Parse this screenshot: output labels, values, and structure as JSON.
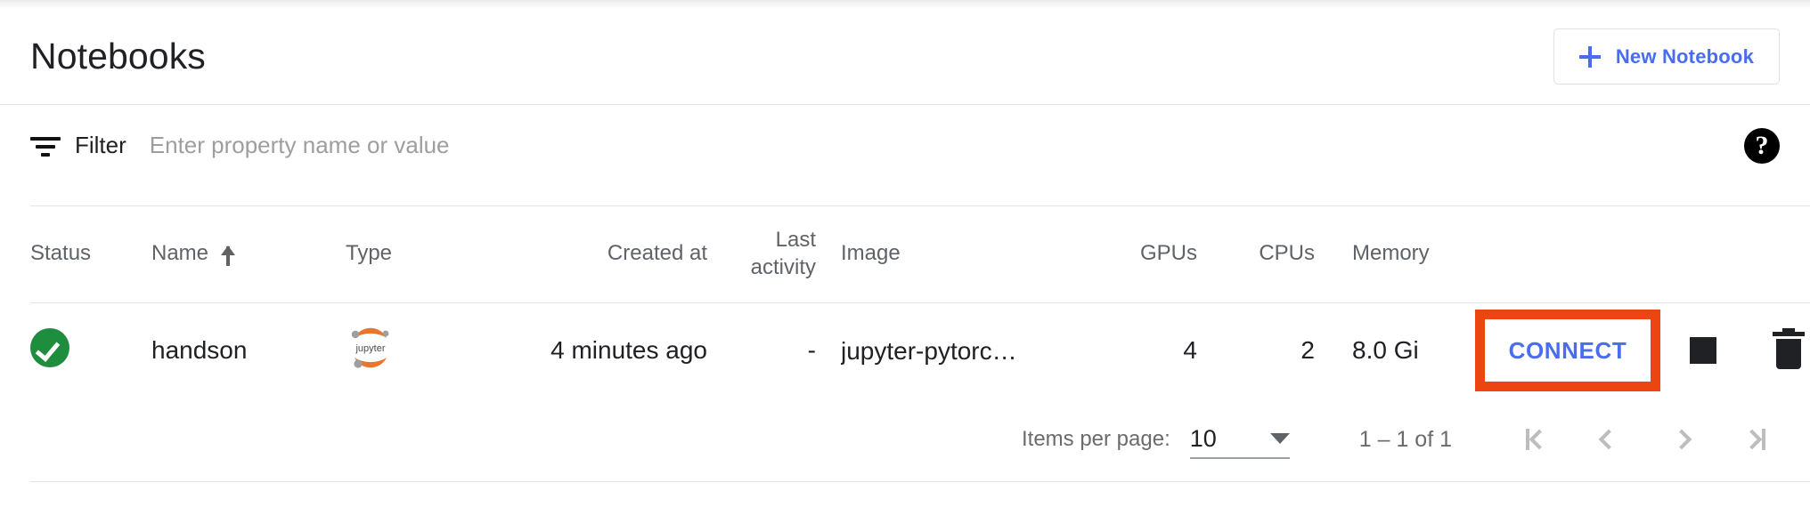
{
  "header": {
    "title": "Notebooks",
    "new_notebook_label": "New Notebook",
    "plus_icon": "plus-icon"
  },
  "filter": {
    "icon": "filter-list-icon",
    "label": "Filter",
    "placeholder": "Enter property name or value",
    "value": "",
    "help_icon": "help-circle-icon",
    "help_glyph": "?"
  },
  "table": {
    "columns": [
      {
        "key": "status",
        "label": "Status",
        "sorted": false
      },
      {
        "key": "name",
        "label": "Name",
        "sorted": true,
        "sort_direction": "asc",
        "sort_icon": "arrow-upward-icon"
      },
      {
        "key": "type",
        "label": "Type",
        "sorted": false
      },
      {
        "key": "created",
        "label": "Created at",
        "sorted": false
      },
      {
        "key": "last",
        "label": "Last activity",
        "sorted": false
      },
      {
        "key": "image",
        "label": "Image",
        "sorted": false
      },
      {
        "key": "gpus",
        "label": "GPUs",
        "sorted": false
      },
      {
        "key": "cpus",
        "label": "CPUs",
        "sorted": false
      },
      {
        "key": "memory",
        "label": "Memory",
        "sorted": false
      },
      {
        "key": "actions",
        "label": "",
        "sorted": false
      }
    ],
    "rows": [
      {
        "status_icon": "check-circle-icon",
        "status_color": "#1e8e3e",
        "name": "handson",
        "type_icon": "jupyter-logo-icon",
        "type_label": "jupyter",
        "created": "4 minutes ago",
        "last_activity": "-",
        "image": "jupyter-pytorc…",
        "gpus": "4",
        "cpus": "2",
        "memory": "8.0 Gi",
        "connect_label": "CONNECT",
        "stop_icon": "stop-square-icon",
        "delete_icon": "trash-icon"
      }
    ]
  },
  "paginator": {
    "items_per_page_label": "Items per page:",
    "page_size": "10",
    "page_size_caret_icon": "chevron-down-icon",
    "range_label": "1 – 1 of 1",
    "first_page_icon": "first-page-icon",
    "prev_page_icon": "chevron-left-icon",
    "next_page_icon": "chevron-right-icon",
    "last_page_icon": "last-page-icon"
  },
  "colors": {
    "accent_blue": "#4a6cf0",
    "status_green": "#1e8e3e",
    "annotation_orange": "#eb4511",
    "text_primary": "#202124",
    "text_secondary": "#5f6368",
    "divider": "#e4e4e4"
  }
}
